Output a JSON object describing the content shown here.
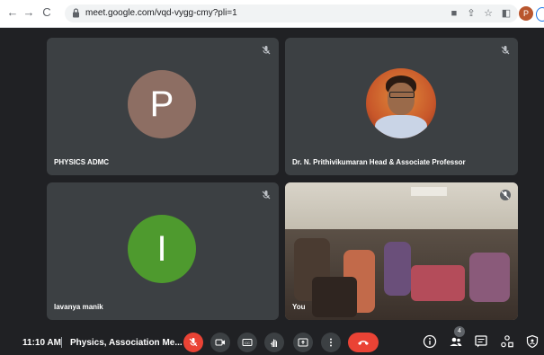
{
  "browser": {
    "url": "meet.google.com/vqd-vygg-cmy?pli=1",
    "profile_initial": "P"
  },
  "tiles": [
    {
      "name": "PHYSICS ADMC",
      "avatar_letter": "P",
      "avatar_color": "#8d6e63"
    },
    {
      "name": "Dr. N. Prithivikumaran Head & Associate Professor"
    },
    {
      "name": "lavanya manik",
      "avatar_letter": "I",
      "avatar_color": "#4e9a2e"
    },
    {
      "name": "You"
    }
  ],
  "bottom_bar": {
    "time": "11:10 AM",
    "meeting_title": "Physics, Association Me...",
    "participants_count": "4"
  },
  "colors": {
    "accent_red": "#ea4335",
    "tile_bg": "#3c4043",
    "page_bg": "#202124"
  }
}
